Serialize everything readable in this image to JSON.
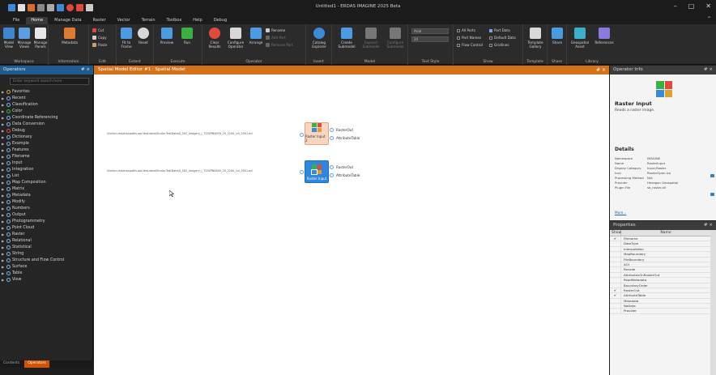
{
  "app": {
    "title": "Untitled1 - ERDAS IMAGINE 2025 Beta",
    "window_controls": [
      "–",
      "□",
      "✕"
    ],
    "ribbon_pin": "^"
  },
  "menu": {
    "tabs": [
      "File",
      "Home",
      "Manage Data",
      "Raster",
      "Vector",
      "Terrain",
      "Toolbox",
      "Help",
      "Debug"
    ],
    "active": "Home"
  },
  "ribbon": {
    "workspace": {
      "label": "Workspace",
      "buttons": [
        "Model View",
        "Manage Views",
        "Manage Panels"
      ]
    },
    "information": {
      "label": "Information",
      "buttons": [
        "Metadata"
      ]
    },
    "edit": {
      "label": "Edit",
      "small": [
        "Cut",
        "Copy",
        "Paste"
      ]
    },
    "extent": {
      "label": "Extent",
      "buttons": [
        "Fit to Frame",
        "Reset"
      ]
    },
    "execute": {
      "label": "Execute",
      "buttons": [
        "Preview",
        "Run"
      ]
    },
    "operator": {
      "label": "Operator",
      "buttons": [
        "Clear Results",
        "Configure Operator",
        "Arrange"
      ],
      "small": [
        "Rename",
        "Add Port",
        "Remove Port"
      ]
    },
    "insert": {
      "label": "Insert",
      "buttons": [
        "Catalog Explorer"
      ]
    },
    "model": {
      "label": "Model",
      "buttons": [
        "Create Submodel",
        "Expand Submodel",
        "Configure Submodel"
      ]
    },
    "text_style": {
      "label": "Text Style",
      "font": "Arial",
      "size": "24"
    },
    "show": {
      "label": "Show",
      "checks": [
        {
          "label": "All Ports",
          "on": false
        },
        {
          "label": "Port Data",
          "on": true
        },
        {
          "label": "Port Names",
          "on": false
        },
        {
          "label": "Default Data",
          "on": false
        },
        {
          "label": "Flow Control",
          "on": false
        },
        {
          "label": "Gridlines",
          "on": false
        }
      ]
    },
    "template": {
      "label": "Template",
      "buttons": [
        "Template Gallery"
      ]
    },
    "share": {
      "label": "Share",
      "buttons": [
        "Share"
      ]
    },
    "library": {
      "label": "Library",
      "buttons": [
        "Geospatial Asset",
        "References"
      ]
    }
  },
  "operators_panel": {
    "title": "Operators",
    "pin": "# ×",
    "search_placeholder": "Enter keyword search here",
    "items": [
      "Favorites",
      "Recent",
      "Classification",
      "Color",
      "Coordinate Referencing",
      "Data Conversion",
      "Debug",
      "Dictionary",
      "Example",
      "Features",
      "Filename",
      "Input",
      "Integration",
      "List",
      "Map Composition",
      "Matrix",
      "Metadata",
      "Modify",
      "Numbers",
      "Output",
      "Photogrammetry",
      "Point Cloud",
      "Raster",
      "Relational",
      "Statistical",
      "String",
      "Structure and Flow Control",
      "Surface",
      "Table",
      "View"
    ],
    "bottom_tabs": [
      "Contents",
      "Operators"
    ],
    "active_bottom_tab": "Operators"
  },
  "editor": {
    "title": "Spatial Model Editor #1 : Spatial Model",
    "close": "# ×",
    "nodes": [
      {
        "label": "Raster Input 2",
        "path": "\\\\helion-mdata\\spotlis-api-test-data\\Studio TestData\\S_002_Imagery_l_T23EPN4876_20_2200_cvl_2001.ecl",
        "ports": [
          "RasterOut",
          "AttributeTable"
        ],
        "selected": false
      },
      {
        "label": "Raster Input",
        "path": "\\\\helion-mdata\\spotlis-api-test-data\\Studio TestData\\S_002_Imagery_l_T23EPN4800_20_2200_cvl_2001.ecl",
        "ports": [
          "RasterOut",
          "AttributeTable"
        ],
        "selected": true
      }
    ]
  },
  "operator_info": {
    "title": "Operator Info",
    "pin": "# ×",
    "name": "Raster Input",
    "description": "Reads a raster image.",
    "details_title": "Details",
    "details": [
      {
        "key": "Namespace",
        "value": "IMAGINE"
      },
      {
        "key": "Name",
        "value": "RasterInput"
      },
      {
        "key": "Display Category",
        "value": "Input;Raster"
      },
      {
        "key": "Icon",
        "value": "RasterOpen.ico"
      },
      {
        "key": "Processing Method",
        "value": "N/A"
      },
      {
        "key": "Provider",
        "value": "Hexagon Geospatial"
      },
      {
        "key": "Plugin File",
        "value": "sb_raster.dll"
      }
    ],
    "more": "More..."
  },
  "properties": {
    "title": "Properties",
    "pin": "# ×",
    "col_show": "Show",
    "col_name": "Name",
    "rows": [
      {
        "name": "Filename",
        "show": true
      },
      {
        "name": "DataType",
        "show": false
      },
      {
        "name": "Interpolation",
        "show": false
      },
      {
        "name": "MapBoundary",
        "show": false
      },
      {
        "name": "FileBoundary",
        "show": false
      },
      {
        "name": "AOI",
        "show": false
      },
      {
        "name": "Recode",
        "show": false
      },
      {
        "name": "AttributesOnRasterOut",
        "show": false
      },
      {
        "name": "ReadMetadata",
        "show": false
      },
      {
        "name": "BoundaryOrder",
        "show": false
      },
      {
        "name": "RasterOut",
        "show": true
      },
      {
        "name": "AttributeTable",
        "show": true
      },
      {
        "name": "Metadata",
        "show": false
      },
      {
        "name": "NoData",
        "show": false
      },
      {
        "name": "Provider",
        "show": false
      }
    ],
    "check_glyph": "✔"
  },
  "colors": {
    "accent_orange": "#d4721a",
    "selected_node": "#2e86de",
    "unselected_node": "#f7d6c0"
  }
}
